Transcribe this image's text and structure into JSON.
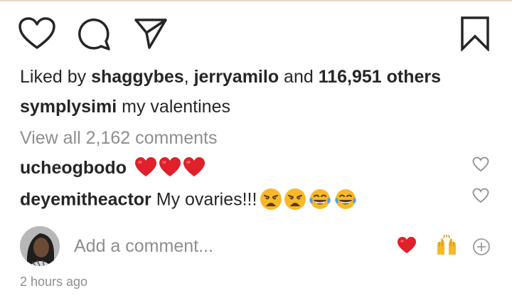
{
  "post": {
    "likes": {
      "prefix": "Liked by ",
      "user1": "shaggybes",
      "separator": ", ",
      "user2": "jerryamilo",
      "conjunction": " and ",
      "others": "116,951 others"
    },
    "caption": {
      "username": "symplysimi",
      "text": "my valentines"
    },
    "view_all_comments": "View all 2,162 comments",
    "comments": [
      {
        "username": "ucheogbodo",
        "text": "",
        "emojis": [
          "red-heart",
          "red-heart",
          "red-heart"
        ]
      },
      {
        "username": "deyemitheactor",
        "text": "My ovaries!!!",
        "emojis": [
          "weary-face",
          "weary-face",
          "tears-of-joy-face",
          "tears-of-joy-face"
        ]
      }
    ],
    "add_comment_placeholder": "Add a comment...",
    "timestamp": "2 hours ago"
  },
  "icons": {
    "like": "heart-outline-icon",
    "comment": "speech-bubble-icon",
    "share": "paper-plane-icon",
    "save": "bookmark-icon",
    "comment_like": "small-heart-outline-icon",
    "quick_heart": "red-heart-emoji",
    "quick_hands": "raised-hands-emoji",
    "quick_more": "plus-circle-icon"
  },
  "colors": {
    "text": "#262626",
    "secondary": "#8e8e8e",
    "heart_red": "#e0202a",
    "emoji_yellow": "#f7b928",
    "tear_blue": "#4aa3f0"
  }
}
